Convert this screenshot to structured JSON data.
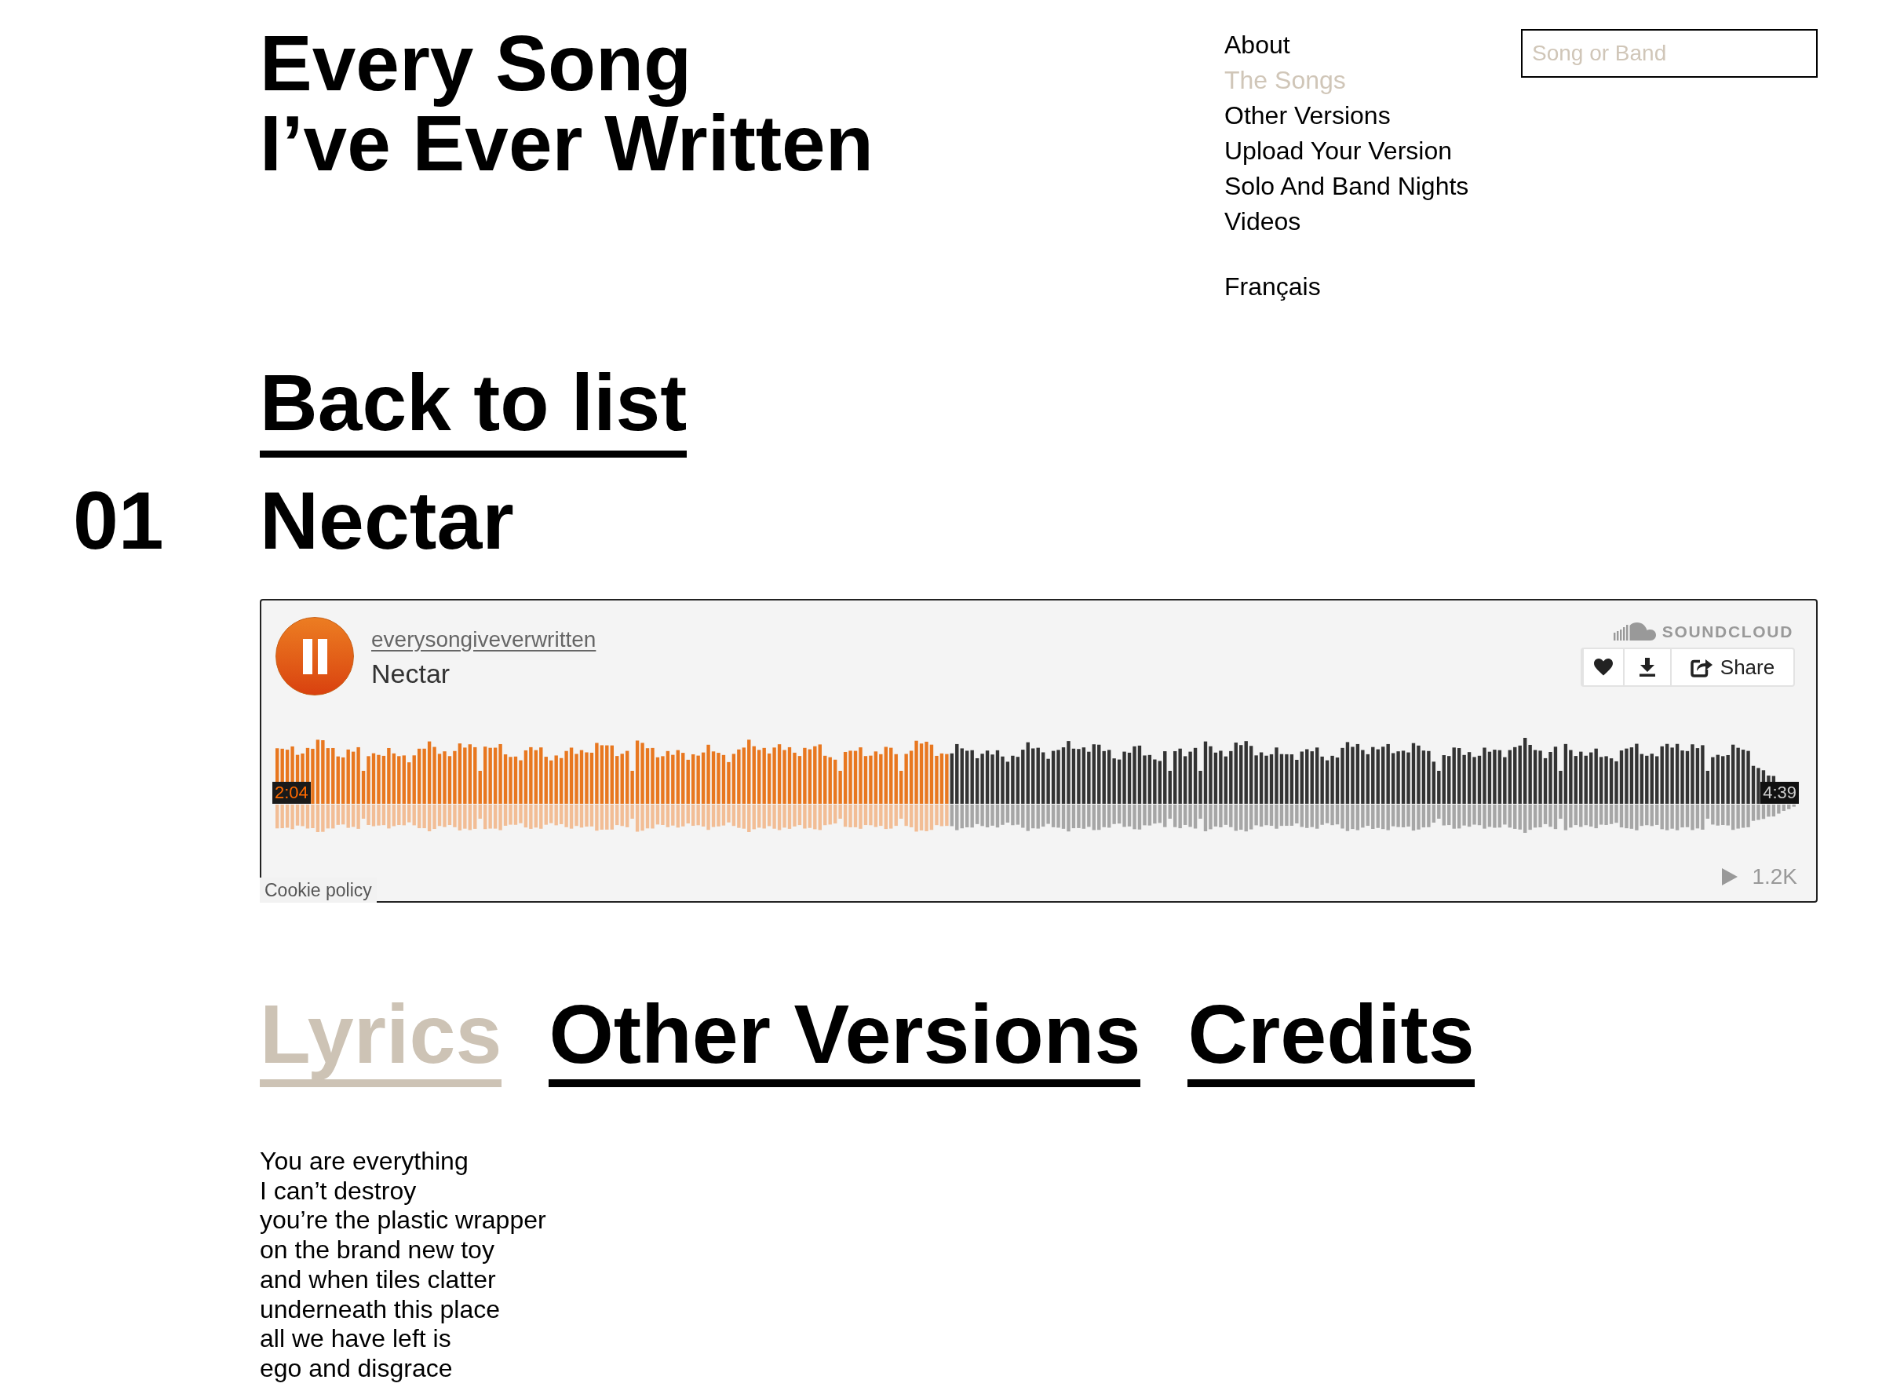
{
  "site_title": [
    "Every Song",
    "I’ve Ever Written"
  ],
  "nav": {
    "items": [
      {
        "label": "About",
        "selected": false
      },
      {
        "label": "The Songs",
        "selected": true
      },
      {
        "label": "Other Versions",
        "selected": false
      },
      {
        "label": "Upload Your Version",
        "selected": false
      },
      {
        "label": "Solo And Band Nights",
        "selected": false
      },
      {
        "label": "Videos",
        "selected": false
      }
    ],
    "language": "Français"
  },
  "search": {
    "placeholder": "Song or Band"
  },
  "back_link": "Back to list",
  "song": {
    "number": "01",
    "title": "Nectar"
  },
  "player": {
    "playing": true,
    "artist": "everysongiveverwritten",
    "track": "Nectar",
    "brand": "SOUNDCLOUD",
    "actions": [
      {
        "kind": "like"
      },
      {
        "kind": "download"
      },
      {
        "kind": "share",
        "label": "Share"
      }
    ],
    "progress": {
      "level": 0.444,
      "elapsed": "2:04",
      "duration": "4:39"
    },
    "plays": "1.2K",
    "cookie_link": "Cookie policy"
  },
  "tabs": [
    {
      "label": "Lyrics",
      "selected": true
    },
    {
      "label": "Other Versions",
      "selected": false
    },
    {
      "label": "Credits",
      "selected": false
    }
  ],
  "lyrics": [
    "You are everything",
    "I can’t destroy",
    "you’re the plastic wrapper",
    "on the brand new toy",
    "and when tiles clatter",
    "underneath this place",
    "all we have left is",
    "ego and disgrace"
  ]
}
